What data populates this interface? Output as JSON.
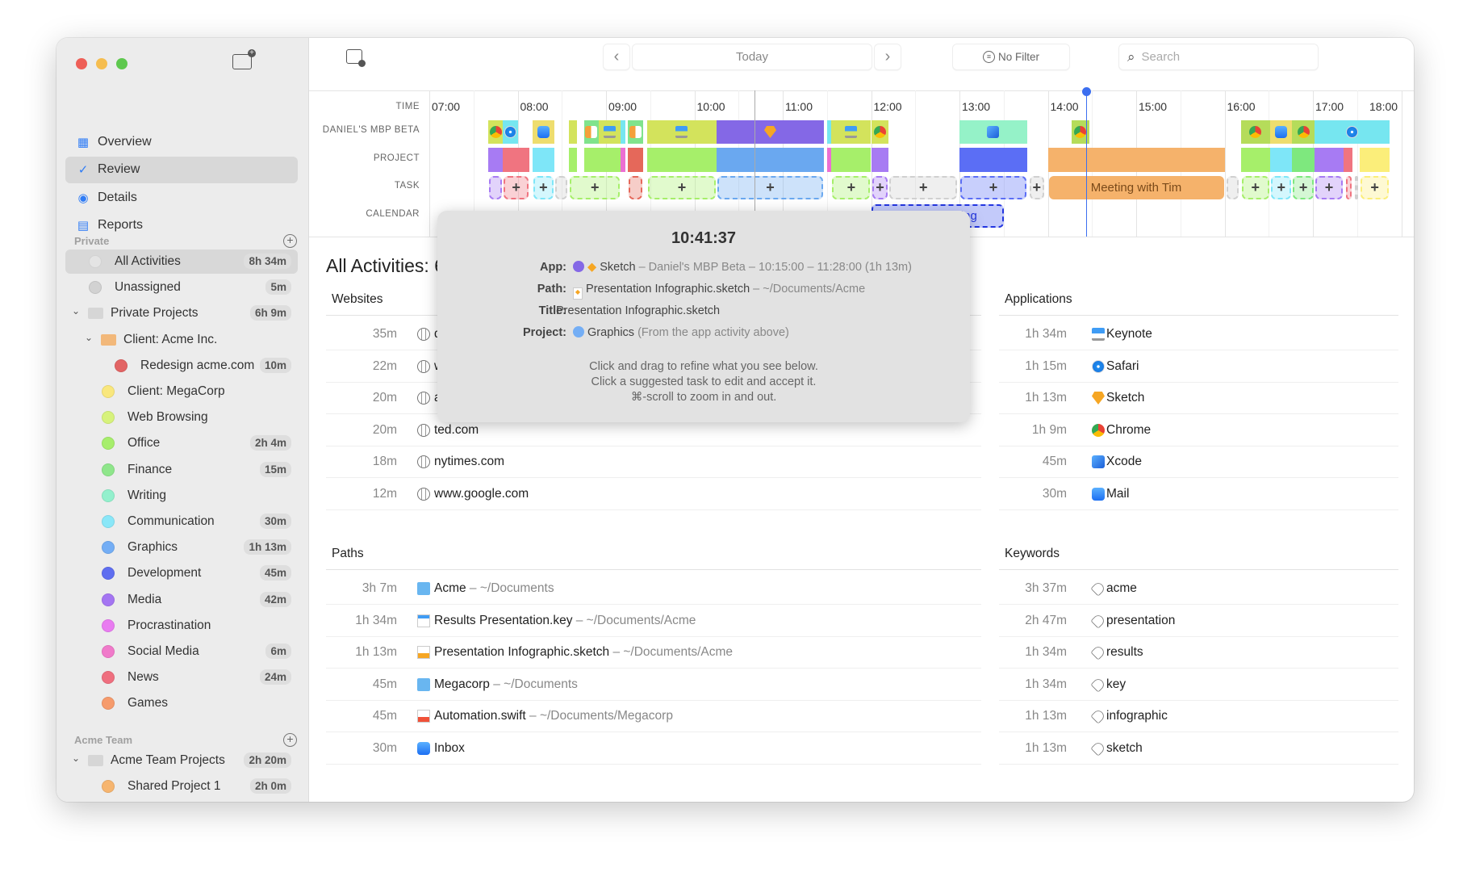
{
  "window_controls": {
    "close": "#ee5f57",
    "minimize": "#f5bd4f",
    "zoom": "#5ec84e"
  },
  "sidebar": {
    "nav": [
      {
        "label": "Overview",
        "icon": "grid-icon",
        "selected": false
      },
      {
        "label": "Review",
        "icon": "check-circle-icon",
        "selected": true
      },
      {
        "label": "Details",
        "icon": "eye-icon",
        "selected": false
      },
      {
        "label": "Reports",
        "icon": "document-icon",
        "selected": false
      }
    ],
    "private_header": "Private",
    "items": [
      {
        "label": "All Activities",
        "badge": "8h 34m",
        "level": 0,
        "kind": "dot",
        "color": "#e4e4e4",
        "selected": true
      },
      {
        "label": "Unassigned",
        "badge": "5m",
        "level": 0,
        "kind": "dot",
        "color": "#d2d2d2"
      },
      {
        "label": "Private Projects",
        "badge": "6h 9m",
        "level": 0,
        "kind": "folder",
        "color": "#d6d6d6",
        "expanded": true
      },
      {
        "label": "Client: Acme Inc.",
        "badge": "",
        "level": 1,
        "kind": "folder",
        "color": "#f2b87a",
        "expanded": true
      },
      {
        "label": "Redesign acme.com",
        "badge": "10m",
        "level": 2,
        "kind": "dot",
        "color": "#e26464"
      },
      {
        "label": "Client: MegaCorp",
        "badge": "",
        "level": 1,
        "kind": "dot",
        "color": "#f9e77d"
      },
      {
        "label": "Web Browsing",
        "badge": "",
        "level": 1,
        "kind": "dot",
        "color": "#d7f27c"
      },
      {
        "label": "Office",
        "badge": "2h 4m",
        "level": 1,
        "kind": "dot",
        "color": "#a7ee6c"
      },
      {
        "label": "Finance",
        "badge": "15m",
        "level": 1,
        "kind": "dot",
        "color": "#8fe68b"
      },
      {
        "label": "Writing",
        "badge": "",
        "level": 1,
        "kind": "dot",
        "color": "#93f0cd"
      },
      {
        "label": "Communication",
        "badge": "30m",
        "level": 1,
        "kind": "dot",
        "color": "#8ae7f8"
      },
      {
        "label": "Graphics",
        "badge": "1h 13m",
        "level": 1,
        "kind": "dot",
        "color": "#74aef5"
      },
      {
        "label": "Development",
        "badge": "45m",
        "level": 1,
        "kind": "dot",
        "color": "#5f6ef0"
      },
      {
        "label": "Media",
        "badge": "42m",
        "level": 1,
        "kind": "dot",
        "color": "#a475f2"
      },
      {
        "label": "Procrastination",
        "badge": "",
        "level": 1,
        "kind": "dot",
        "color": "#e97cf1"
      },
      {
        "label": "Social Media",
        "badge": "6m",
        "level": 1,
        "kind": "dot",
        "color": "#f07aca"
      },
      {
        "label": "News",
        "badge": "24m",
        "level": 1,
        "kind": "dot",
        "color": "#ef6f7f"
      },
      {
        "label": "Games",
        "badge": "",
        "level": 1,
        "kind": "dot",
        "color": "#f69b6c"
      }
    ],
    "team_header": "Acme Team",
    "team_items": [
      {
        "label": "Acme Team Projects",
        "badge": "2h 20m",
        "level": 0,
        "kind": "folder",
        "color": "#d6d6d6",
        "expanded": true
      },
      {
        "label": "Shared Project 1",
        "badge": "2h 0m",
        "level": 1,
        "kind": "dot",
        "color": "#f6b56f"
      }
    ]
  },
  "toolbar": {
    "date_label": "Today",
    "filter_label": "No Filter",
    "search_placeholder": "Search"
  },
  "timeline": {
    "row_labels": {
      "time": "TIME",
      "device": "DANIEL'S MBP BETA",
      "project": "PROJECT",
      "task": "TASK",
      "calendar": "CALENDAR"
    },
    "hours": [
      "07:00",
      "08:00",
      "09:00",
      "10:00",
      "11:00",
      "12:00",
      "13:00",
      "14:00",
      "15:00",
      "16:00",
      "17:00",
      "18:00"
    ],
    "current_time": "14:26",
    "hover_time": "10:41",
    "app_segments": [
      {
        "start": "07:40",
        "end": "07:50",
        "color": "#d3e35c",
        "icon": "chrome"
      },
      {
        "start": "07:50",
        "end": "08:00",
        "color": "#76e6f0",
        "icon": "safari"
      },
      {
        "start": "08:10",
        "end": "08:25",
        "color": "#eedd6e",
        "icon": "mail"
      },
      {
        "start": "08:35",
        "end": "08:40",
        "color": "#d3e35c",
        "icon": ""
      },
      {
        "start": "08:45",
        "end": "08:55",
        "color": "#80e38c",
        "icon": "numbers"
      },
      {
        "start": "08:55",
        "end": "09:10",
        "color": "#d3e35c",
        "icon": "keynote"
      },
      {
        "start": "09:10",
        "end": "09:13",
        "color": "#76e6f0",
        "icon": ""
      },
      {
        "start": "09:15",
        "end": "09:25",
        "color": "#80e38c",
        "icon": "numbers"
      },
      {
        "start": "09:28",
        "end": "10:15",
        "color": "#d3e35c",
        "icon": "keynote"
      },
      {
        "start": "10:15",
        "end": "11:28",
        "color": "#8468e6",
        "icon": "sketch"
      },
      {
        "start": "11:30",
        "end": "11:33",
        "color": "#76e6f0",
        "icon": ""
      },
      {
        "start": "11:33",
        "end": "12:00",
        "color": "#d3e35c",
        "icon": "keynote"
      },
      {
        "start": "12:00",
        "end": "12:12",
        "color": "#d3e35c",
        "icon": "chrome"
      },
      {
        "start": "13:00",
        "end": "13:46",
        "color": "#95f2c8",
        "icon": "xcode"
      },
      {
        "start": "14:16",
        "end": "14:28",
        "color": "#b5dc5a",
        "icon": "chrome"
      },
      {
        "start": "16:11",
        "end": "16:31",
        "color": "#b5dc5a",
        "icon": "chrome"
      },
      {
        "start": "16:31",
        "end": "16:46",
        "color": "#eedd6e",
        "icon": "mail"
      },
      {
        "start": "16:46",
        "end": "17:01",
        "color": "#b5dc5a",
        "icon": "chrome"
      },
      {
        "start": "17:01",
        "end": "17:52",
        "color": "#76e6f0",
        "icon": "safari"
      }
    ],
    "project_segments": [
      {
        "start": "07:40",
        "end": "07:50",
        "color": "#a77bf3"
      },
      {
        "start": "07:50",
        "end": "08:08",
        "color": "#f07480"
      },
      {
        "start": "08:10",
        "end": "08:25",
        "color": "#7ee6f8"
      },
      {
        "start": "08:35",
        "end": "08:40",
        "color": "#a6ef6a"
      },
      {
        "start": "08:45",
        "end": "09:10",
        "color": "#a6ef6a"
      },
      {
        "start": "09:10",
        "end": "09:13",
        "color": "#ec6fd2"
      },
      {
        "start": "09:15",
        "end": "09:25",
        "color": "#e5685a"
      },
      {
        "start": "09:28",
        "end": "10:15",
        "color": "#a6ef6a"
      },
      {
        "start": "10:15",
        "end": "11:28",
        "color": "#6aa8f0"
      },
      {
        "start": "11:30",
        "end": "11:33",
        "color": "#ec6fd2"
      },
      {
        "start": "11:33",
        "end": "12:00",
        "color": "#a6ef6a"
      },
      {
        "start": "12:00",
        "end": "12:12",
        "color": "#a77bf3"
      },
      {
        "start": "13:00",
        "end": "13:46",
        "color": "#5b6ef5"
      },
      {
        "start": "14:00",
        "end": "16:00",
        "color": "#f5b26b"
      },
      {
        "start": "16:11",
        "end": "16:31",
        "color": "#a6ef6a"
      },
      {
        "start": "16:31",
        "end": "16:46",
        "color": "#7ee6f8"
      },
      {
        "start": "16:46",
        "end": "17:01",
        "color": "#7ee87e"
      },
      {
        "start": "17:01",
        "end": "17:21",
        "color": "#a77bf3"
      },
      {
        "start": "17:21",
        "end": "17:27",
        "color": "#f07480"
      },
      {
        "start": "17:32",
        "end": "17:52",
        "color": "#fbee7a"
      }
    ],
    "task_segments": [
      {
        "start": "07:40",
        "end": "07:50",
        "color": "#a77bf3",
        "plus": false
      },
      {
        "start": "07:50",
        "end": "08:08",
        "color": "#f07480",
        "plus": true
      },
      {
        "start": "08:10",
        "end": "08:25",
        "color": "#7ee6f8",
        "plus": true
      },
      {
        "start": "08:25",
        "end": "08:34",
        "color": "#d0d0d0",
        "plus": false
      },
      {
        "start": "08:35",
        "end": "09:10",
        "color": "#a6ef6a",
        "plus": true
      },
      {
        "start": "09:15",
        "end": "09:25",
        "color": "#e5685a",
        "plus": false
      },
      {
        "start": "09:28",
        "end": "10:15",
        "color": "#a6ef6a",
        "plus": true
      },
      {
        "start": "10:15",
        "end": "11:28",
        "color": "#6aa8f0",
        "plus": true
      },
      {
        "start": "11:33",
        "end": "12:00",
        "color": "#a6ef6a",
        "plus": true
      },
      {
        "start": "12:00",
        "end": "12:12",
        "color": "#a77bf3",
        "plus": true
      },
      {
        "start": "12:12",
        "end": "12:59",
        "color": "#d0d0d0",
        "plus": true
      },
      {
        "start": "13:00",
        "end": "13:46",
        "color": "#5b6ef5",
        "plus": true
      },
      {
        "start": "13:47",
        "end": "13:58",
        "color": "#d0d0d0",
        "plus": true
      },
      {
        "start": "14:00",
        "end": "16:00",
        "color": "#f5b26b",
        "plus": false,
        "label": "Meeting with Tim",
        "solid": true
      },
      {
        "start": "16:01",
        "end": "16:10",
        "color": "#d0d0d0",
        "plus": false
      },
      {
        "start": "16:11",
        "end": "16:31",
        "color": "#a6ef6a",
        "plus": true
      },
      {
        "start": "16:31",
        "end": "16:46",
        "color": "#7ee6f8",
        "plus": true
      },
      {
        "start": "16:46",
        "end": "17:01",
        "color": "#7ee87e",
        "plus": true
      },
      {
        "start": "17:01",
        "end": "17:21",
        "color": "#a77bf3",
        "plus": true
      },
      {
        "start": "17:22",
        "end": "17:27",
        "color": "#f07480",
        "plus": false
      },
      {
        "start": "17:28",
        "end": "17:31",
        "color": "#d0d0d0",
        "plus": false
      },
      {
        "start": "17:32",
        "end": "17:52",
        "color": "#fbee7a",
        "plus": true
      }
    ],
    "calendar_events": [
      {
        "start": "12:00",
        "end": "13:30",
        "label": "Lunch Meeting",
        "color": "#2336e0"
      }
    ]
  },
  "content": {
    "title": "All Activities: 6h 46",
    "websites": {
      "header": "Websites",
      "rows": [
        {
          "time": "35m",
          "name": "docs.goo"
        },
        {
          "time": "22m",
          "name": "www.yout"
        },
        {
          "time": "20m",
          "name": "arstechni"
        },
        {
          "time": "20m",
          "name": "ted.com"
        },
        {
          "time": "18m",
          "name": "nytimes.com"
        },
        {
          "time": "12m",
          "name": "www.google.com"
        }
      ]
    },
    "applications": {
      "header": "Applications",
      "rows": [
        {
          "time": "1h 34m",
          "name": "Keynote",
          "icon": "keynote"
        },
        {
          "time": "1h 15m",
          "name": "Safari",
          "icon": "safari"
        },
        {
          "time": "1h 13m",
          "name": "Sketch",
          "icon": "sketch"
        },
        {
          "time": "1h 9m",
          "name": "Chrome",
          "icon": "chrome"
        },
        {
          "time": "45m",
          "name": "Xcode",
          "icon": "xcode"
        },
        {
          "time": "30m",
          "name": "Mail",
          "icon": "mail"
        }
      ]
    },
    "paths": {
      "header": "Paths",
      "rows": [
        {
          "time": "3h 7m",
          "name": "Acme",
          "sub": " – ~/Documents",
          "icon": "folder"
        },
        {
          "time": "1h 34m",
          "name": "Results Presentation.key",
          "sub": " – ~/Documents/Acme",
          "icon": "keynote-file"
        },
        {
          "time": "1h 13m",
          "name": "Presentation Infographic.sketch",
          "sub": " – ~/Documents/Acme",
          "icon": "sketch-file"
        },
        {
          "time": "45m",
          "name": "Megacorp",
          "sub": " – ~/Documents",
          "icon": "folder"
        },
        {
          "time": "45m",
          "name": "Automation.swift",
          "sub": " – ~/Documents/Megacorp",
          "icon": "swift-file"
        },
        {
          "time": "30m",
          "name": "Inbox",
          "sub": "",
          "icon": "mail"
        }
      ]
    },
    "keywords": {
      "header": "Keywords",
      "rows": [
        {
          "time": "3h 37m",
          "name": "acme"
        },
        {
          "time": "2h 47m",
          "name": "presentation"
        },
        {
          "time": "1h 34m",
          "name": "results"
        },
        {
          "time": "1h 34m",
          "name": "key"
        },
        {
          "time": "1h 13m",
          "name": "infographic"
        },
        {
          "time": "1h 13m",
          "name": "sketch"
        }
      ]
    }
  },
  "tooltip": {
    "time": "10:41:37",
    "app_label": "App:",
    "app_name": "Sketch",
    "app_detail": " – Daniel's MBP Beta – 10:15:00 – 11:28:00 (1h 13m)",
    "path_label": "Path:",
    "path_name": "Presentation Infographic.sketch",
    "path_detail": " – ~/Documents/Acme",
    "title_label": "Title:",
    "title_value": "Presentation Infographic.sketch",
    "project_label": "Project:",
    "project_name": "Graphics",
    "project_detail": " (From the app activity above)",
    "help": [
      "Click and drag to refine what you see below.",
      "Click a suggested task to edit and accept it.",
      "⌘-scroll to zoom in and out."
    ]
  }
}
